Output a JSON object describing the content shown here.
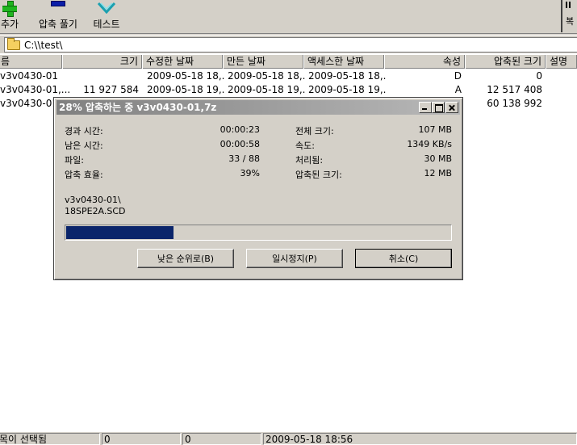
{
  "toolbar": {
    "add_label": "추가",
    "extract_label": "압축 풀기",
    "test_label": "테스트",
    "right_label": "복"
  },
  "address": {
    "path": "C:\\\\test\\"
  },
  "columns": [
    "름",
    "크기",
    "수정한 날짜",
    "만든 날짜",
    "액세스한 날짜",
    "속성",
    "압축된 크기",
    "설명"
  ],
  "files": [
    {
      "name": "v3v0430-01",
      "size": "",
      "modified": "2009-05-18 18,..",
      "created": "2009-05-18 18,..",
      "accessed": "2009-05-18 18,..",
      "attr": "D",
      "packed": "0"
    },
    {
      "name": "v3v0430-01,...",
      "size": "11 927 584",
      "modified": "2009-05-18 19,..",
      "created": "2009-05-18 19,..",
      "accessed": "2009-05-18 19,..",
      "attr": "A",
      "packed": "12 517 408"
    },
    {
      "name": "v3v0430-01,...",
      "size": "",
      "modified": "",
      "created": "",
      "accessed": "",
      "attr": "",
      "packed": "60 138 992"
    }
  ],
  "dialog": {
    "title": "28% 압축하는 중 v3v0430-01,7z",
    "elapsed_label": "경과 시간:",
    "elapsed_value": "00:00:23",
    "remaining_label": "남은 시간:",
    "remaining_value": "00:00:58",
    "files_label": "파일:",
    "files_value": "33 / 88",
    "ratio_label": "압축 효율:",
    "ratio_value": "39%",
    "total_label": "전체 크기:",
    "total_value": "107 MB",
    "speed_label": "속도:",
    "speed_value": "1349 KB/s",
    "processed_label": "처리됨:",
    "processed_value": "30 MB",
    "packed_label": "압축된 크기:",
    "packed_value": "12 MB",
    "current_dir": "v3v0430-01\\",
    "current_file": "18SPE2A.SCD",
    "progress_percent": 28,
    "btn_low_priority": "낮은 순위로(B)",
    "btn_pause": "일시정지(P)",
    "btn_cancel": "취소(C)"
  },
  "status": {
    "selected": "목이 선택됨",
    "val1": "0",
    "val2": "0",
    "date": "2009-05-18 18:56"
  },
  "colors": {
    "progress": "#0a246a",
    "title_start": "#808080",
    "title_end": "#b8b8b8",
    "window_bg": "#d4d0c8"
  }
}
